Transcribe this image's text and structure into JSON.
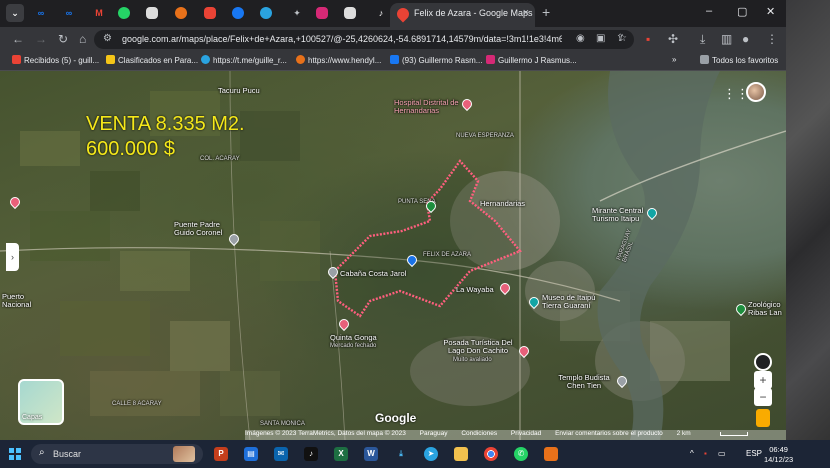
{
  "browser": {
    "active_tab_title": "Felix de Azara - Google Maps",
    "new_tab_glyph": "+",
    "close_tab_glyph": "×",
    "url": "google.com.ar/maps/place/Felix+de+Azara,+100527/@-25,4260624,-54.6891714,14579m/data=!3m1!1e3!4m6!3m5!...",
    "window_controls": [
      "–",
      "▢",
      "✕"
    ]
  },
  "bookmarks": [
    {
      "label": "Recibidos (5) - guill...",
      "color": "#ea4335"
    },
    {
      "label": "Clasificados en Para...",
      "color": "#f5c518"
    },
    {
      "label": "https://t.me/guille_r...",
      "color": "#2aa3e0"
    },
    {
      "label": "https://www.hendyl...",
      "color": "#e8711a"
    },
    {
      "label": "(93) Guillermo Rasm...",
      "color": "#1877f2"
    },
    {
      "label": "Guillermo J Rasmus...",
      "color": "#d62976"
    },
    {
      "label": "Todos los favoritos",
      "color": "#9aa0a6"
    }
  ],
  "sale_overlay": {
    "line1": "VENTA 8.335 M2.",
    "line2": "600.000 $"
  },
  "map_labels": {
    "tacuru": "Tacuru Pucu",
    "hospital": "Hospital Distrital de Hernandarias",
    "hernandarias": "Hernandarias",
    "punta_sena": "PUNTA SENA",
    "felix": "FELIX DE AZARA",
    "cabana": "Cabaña Costa Jarol",
    "wayaba": "La Wayaba",
    "mirante": "Mirante Central Turismo Itaipu",
    "paraguay": "PARAGUAY BRASIL",
    "museo": "Museo de Itaipú Tierra Guaraní",
    "quinta": "Quinta Gonga",
    "quinta_sub": "Mercado fechado",
    "posada": "Posada Turística Del Lago Don Cachito",
    "posada_sub": "Muito avaliado",
    "templo": "Templo Budista Chen Tien",
    "zoo": "Zoológico Ribas Lan",
    "padre": "Puente Padre Guido Coronel",
    "puerto": "Puerto Nacional",
    "acaray": "COL. ACARAY",
    "nueva": "NUEVA ESPERANZA",
    "calle_acaray": "CALLE 8 ACARAY",
    "santa_monica": "SANTA MONICA",
    "capas": "Capas"
  },
  "map_controls": {
    "zoom_in": "+",
    "zoom_out": "−",
    "collapse": "›"
  },
  "google_logo": "Google",
  "attribution": {
    "imagery": "Imágenes © 2023 TerraMetrics, Datos del mapa © 2023",
    "country": "Paraguay",
    "terms": "Condiciones",
    "privacy": "Privacidad",
    "feedback": "Enviar comentarios sobre el producto",
    "scale": "2 km"
  },
  "taskbar": {
    "search_placeholder": "Buscar",
    "lang": "ESP",
    "time": "06:49",
    "date": "14/12/23"
  }
}
